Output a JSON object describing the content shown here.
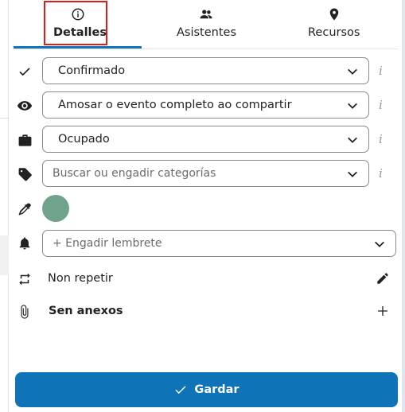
{
  "tabs": [
    {
      "label": "Detalles",
      "icon": "info-circle-icon",
      "active": true
    },
    {
      "label": "Asistentes",
      "icon": "people-icon",
      "active": false
    },
    {
      "label": "Recursos",
      "icon": "map-pin-icon",
      "active": false
    }
  ],
  "fields": {
    "status": {
      "value": "Confirmado",
      "icon": "check-icon"
    },
    "visibility": {
      "value": "Amosar o evento completo ao compartir",
      "icon": "eye-icon"
    },
    "availability": {
      "value": "Ocupado",
      "icon": "briefcase-icon"
    },
    "categories": {
      "placeholder": "Buscar ou engadir categorías",
      "icon": "tag-icon"
    },
    "color": {
      "value": "#6fa38c",
      "icon": "eyedropper-icon"
    },
    "reminder": {
      "placeholder": "+ Engadir lembrete",
      "icon": "bell-icon"
    },
    "repeat": {
      "label": "Non repetir",
      "icon": "repeat-icon",
      "action_icon": "pencil-icon"
    },
    "attachments": {
      "label": "Sen anexos",
      "icon": "paperclip-icon",
      "action_icon": "plus-icon"
    }
  },
  "info_marker": "i",
  "save_button": {
    "label": "Gardar",
    "icon": "check-icon"
  },
  "colors": {
    "accent": "#0f73b8",
    "highlight": "#e01b1b"
  }
}
